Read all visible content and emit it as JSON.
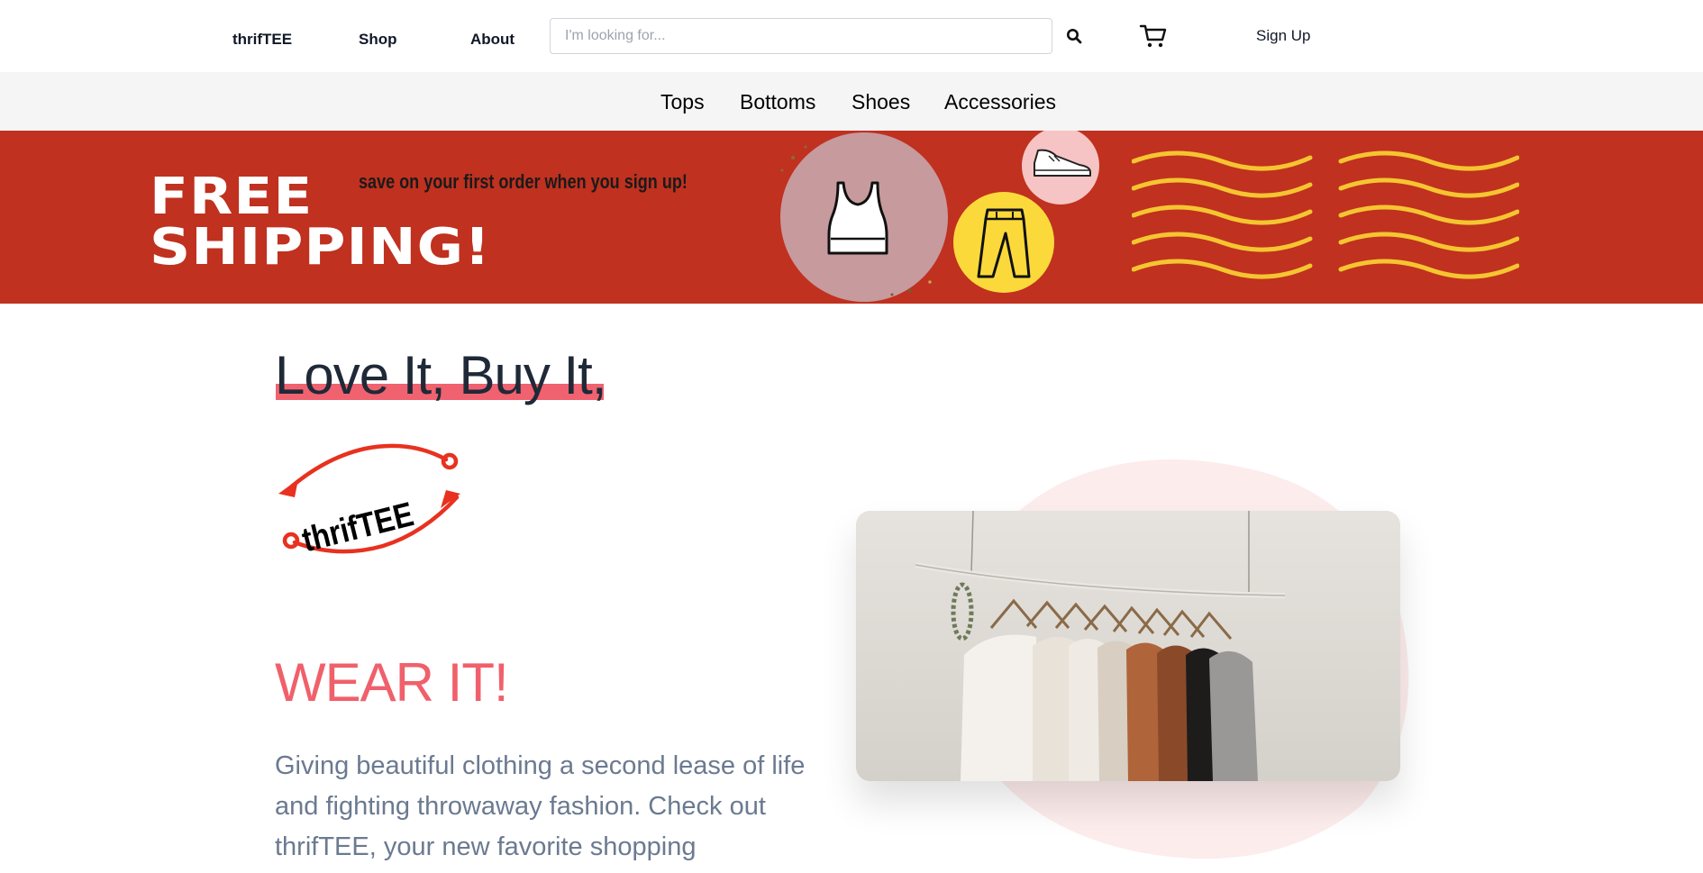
{
  "nav": {
    "brand": "thrifTEE",
    "shop": "Shop",
    "about": "About",
    "search_placeholder": "I'm looking for...",
    "search_icon": "search-icon",
    "cart_icon": "cart-icon",
    "signup": "Sign Up"
  },
  "categories": [
    "Tops",
    "Bottoms",
    "Shoes",
    "Accessories"
  ],
  "banner": {
    "line1": "FREE",
    "line2": "SHIPPING!",
    "tagline": "save on your first order when you sign up!",
    "icons": [
      "tank-top-icon",
      "pants-icon",
      "sneaker-icon"
    ],
    "colors": {
      "background": "#c0311f",
      "waves": "#f5c531"
    }
  },
  "hero": {
    "headline": "Love It, Buy It,",
    "logo_text": "thrifTEE",
    "wear": "WEAR IT!",
    "description": "Giving beautiful clothing a second lease of life and fighting throwaway fashion. Check out thrifTEE, your new favorite shopping",
    "accent": "#f0606b"
  }
}
